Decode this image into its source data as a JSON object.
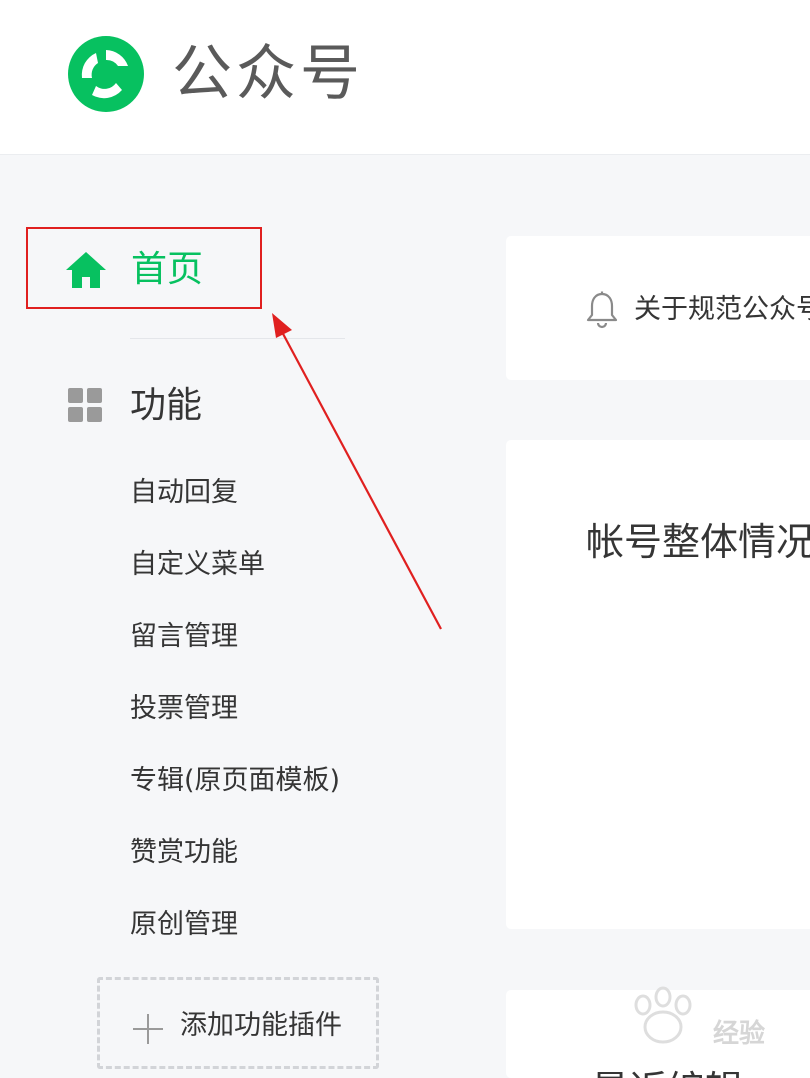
{
  "header": {
    "logo_text": "公众号",
    "brand_color": "#07c160"
  },
  "sidebar": {
    "home": {
      "label": "首页",
      "icon": "home-icon",
      "active_color": "#07c160"
    },
    "function_section": {
      "label": "功能",
      "icon": "grid-icon"
    },
    "items": [
      {
        "label": "自动回复"
      },
      {
        "label": "自定义菜单"
      },
      {
        "label": "留言管理"
      },
      {
        "label": "投票管理"
      },
      {
        "label": "专辑(原页面模板)"
      },
      {
        "label": "赞赏功能"
      },
      {
        "label": "原创管理"
      }
    ],
    "add_plugin": {
      "label": "添加功能插件",
      "icon": "plus-icon"
    }
  },
  "main": {
    "notice": {
      "icon": "bell-icon",
      "text": "关于规范公众号"
    },
    "overview_card": {
      "title": "帐号整体情况"
    },
    "recent_card": {
      "title": "最近编辑"
    }
  },
  "annotation": {
    "highlight_color": "#e02020"
  },
  "watermark": {
    "text": "经验"
  }
}
